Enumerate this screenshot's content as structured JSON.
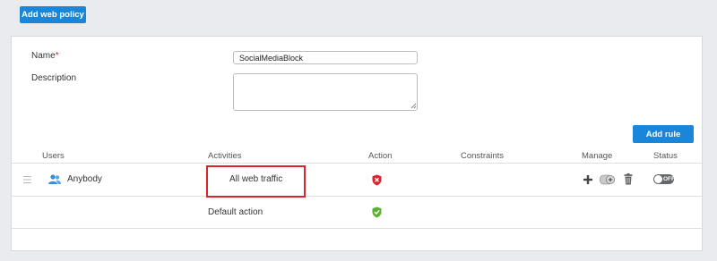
{
  "toolbar": {
    "add_policy_label": "Add web policy"
  },
  "form": {
    "name_label": "Name",
    "required_marker": "*",
    "name_value": "SocialMediaBlock",
    "description_label": "Description",
    "description_value": ""
  },
  "rules": {
    "add_rule_label": "Add rule",
    "columns": [
      "Users",
      "Activities",
      "Action",
      "Constraints",
      "Manage",
      "Status"
    ],
    "rows": [
      {
        "users": "Anybody",
        "activity": "All web traffic",
        "action": "block",
        "action_icon": "red-block-shield-icon",
        "constraints": "",
        "status": "OFF",
        "status_on": false,
        "highlighted": true,
        "highlight_color": "#d9262c"
      }
    ],
    "default_row": {
      "activity": "Default action",
      "action": "allow",
      "action_icon": "green-allow-shield-icon"
    }
  },
  "colors": {
    "accent": "#1a86d9",
    "block": "#d9262c",
    "allow": "#5db130",
    "user_icon": "#2f8fe3"
  }
}
